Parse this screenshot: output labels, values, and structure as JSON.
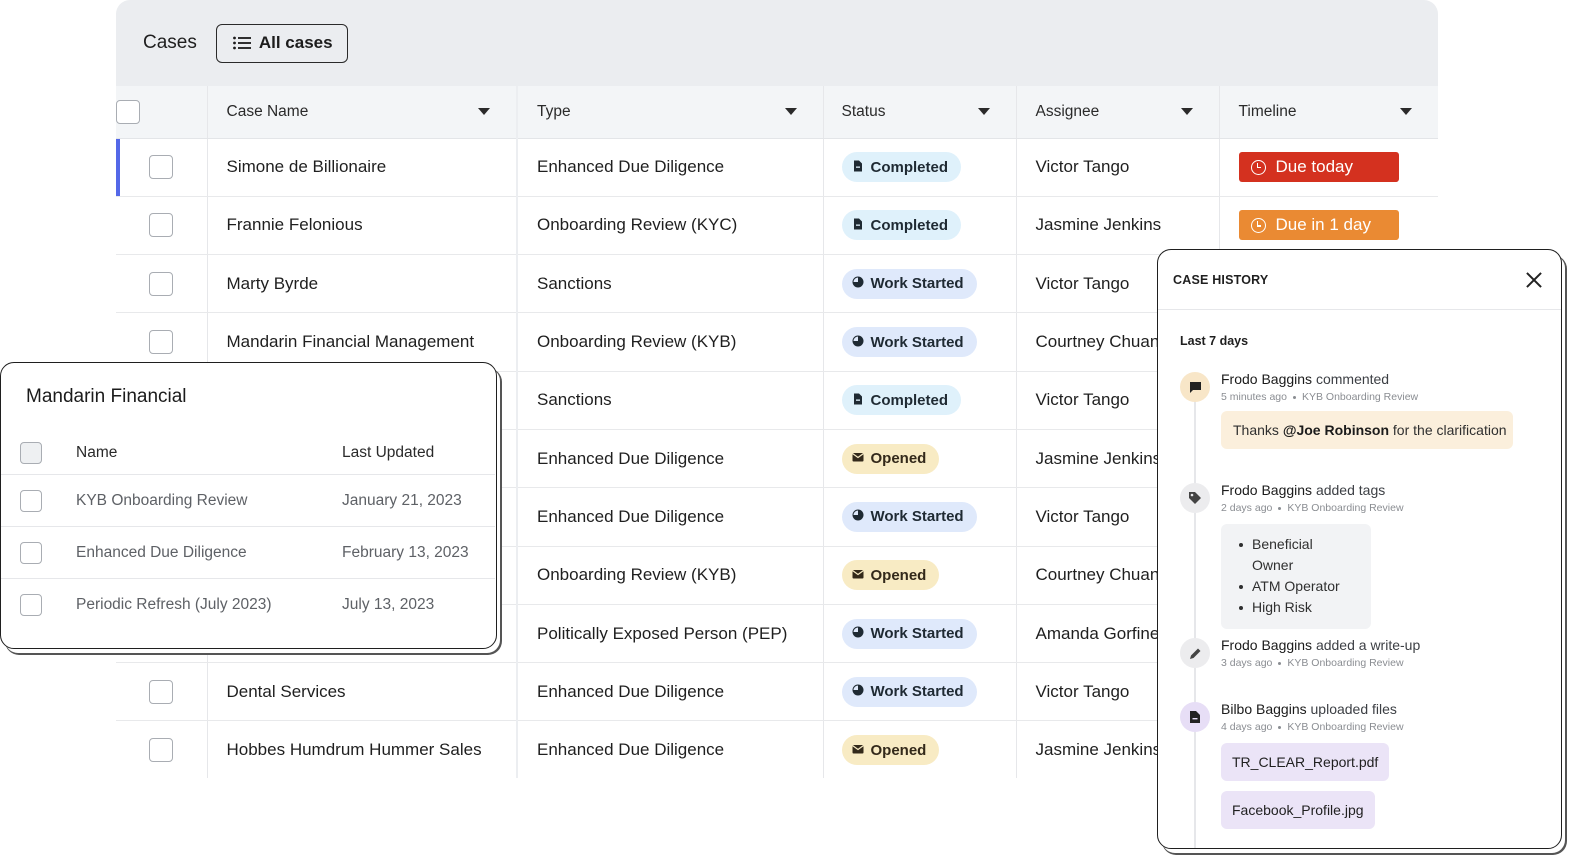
{
  "header": {
    "title": "Cases",
    "view_button": "All cases"
  },
  "columns": {
    "name": "Case Name",
    "type": "Type",
    "status": "Status",
    "assignee": "Assignee",
    "timeline": "Timeline"
  },
  "rows": [
    {
      "name": "Simone de Billionaire",
      "type": "Enhanced Due Diligence",
      "status": "Completed",
      "assignee": "Victor Tango",
      "timeline": "Due today",
      "selected": true
    },
    {
      "name": "Frannie Felonious",
      "type": "Onboarding Review (KYC)",
      "status": "Completed",
      "assignee": "Jasmine Jenkins",
      "timeline": "Due in 1 day"
    },
    {
      "name": "Marty Byrde",
      "type": "Sanctions",
      "status": "Work Started",
      "assignee": "Victor Tango",
      "timeline": ""
    },
    {
      "name": "Mandarin Financial Management",
      "type": "Onboarding Review (KYB)",
      "status": "Work Started",
      "assignee": "Courtney Chuan",
      "timeline": ""
    },
    {
      "name": "",
      "type": "Sanctions",
      "status": "Completed",
      "assignee": "Victor Tango",
      "timeline": ""
    },
    {
      "name": "",
      "type": "Enhanced Due Diligence",
      "status": "Opened",
      "assignee": "Jasmine Jenkins",
      "timeline": ""
    },
    {
      "name": "",
      "type": "Enhanced Due Diligence",
      "status": "Work Started",
      "assignee": "Victor Tango",
      "timeline": ""
    },
    {
      "name": "",
      "type": "Onboarding Review (KYB)",
      "status": "Opened",
      "assignee": "Courtney Chuan",
      "timeline": ""
    },
    {
      "name": "",
      "type": "Politically Exposed Person (PEP)",
      "status": "Work Started",
      "assignee": "Amanda Gorfine",
      "timeline": ""
    },
    {
      "name": "Dental Services",
      "type": "Enhanced Due Diligence",
      "status": "Work Started",
      "assignee": "Victor Tango",
      "timeline": ""
    },
    {
      "name": "Hobbes Humdrum Hummer Sales",
      "type": "Enhanced Due Diligence",
      "status": "Opened",
      "assignee": "Jasmine Jenkins",
      "timeline": ""
    }
  ],
  "status_icons": {
    "Completed": "document-icon",
    "Work Started": "progress-icon",
    "Opened": "envelope-icon"
  },
  "colors": {
    "accent": "#5468e8",
    "due_today": "#d4311f",
    "due_soon": "#ea8a33"
  },
  "mandarin": {
    "title": "Mandarin Financial",
    "col_name": "Name",
    "col_updated": "Last Updated",
    "items": [
      {
        "name": "KYB Onboarding Review",
        "updated": "January 21, 2023"
      },
      {
        "name": "Enhanced Due Diligence",
        "updated": "February 13, 2023"
      },
      {
        "name": "Periodic Refresh (July 2023)",
        "updated": "July 13, 2023"
      }
    ]
  },
  "history": {
    "title": "CASE HISTORY",
    "period": "Last 7 days",
    "events": [
      {
        "actor": "Frodo Baggins",
        "action": "commented",
        "time": "5 minutes ago",
        "context": "KYB Onboarding Review",
        "comment_prefix": "Thanks ",
        "comment_mention": "@Joe Robinson",
        "comment_suffix": " for the clarification"
      },
      {
        "actor": "Frodo Baggins",
        "action": "added tags",
        "time": "2 days ago",
        "context": "KYB Onboarding Review",
        "tags": [
          "Beneficial Owner",
          "ATM Operator",
          "High Risk"
        ]
      },
      {
        "actor": "Frodo Baggins",
        "action": "added a write-up",
        "time": "3 days ago",
        "context": "KYB Onboarding Review"
      },
      {
        "actor": "Bilbo Baggins",
        "action": "uploaded files",
        "time": "4 days ago",
        "context": "KYB Onboarding Review",
        "files": [
          "TR_CLEAR_Report.pdf",
          "Facebook_Profile.jpg"
        ]
      }
    ]
  }
}
